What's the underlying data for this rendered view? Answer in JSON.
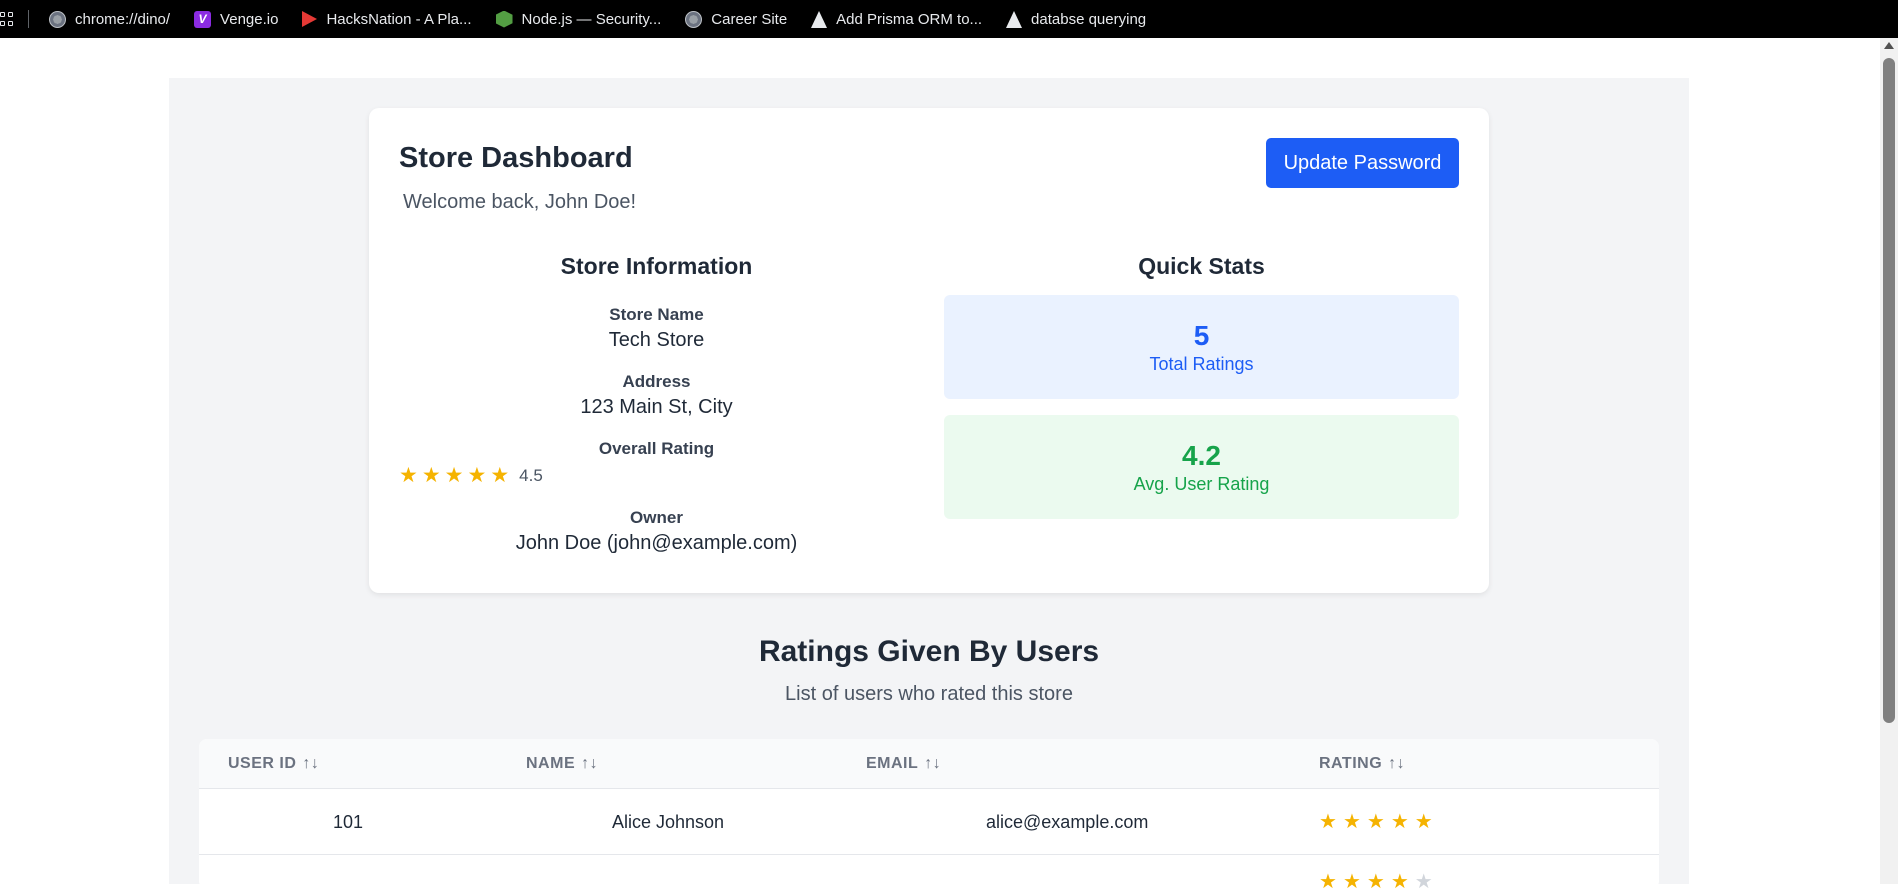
{
  "bookmarks": [
    {
      "label": "chrome://dino/",
      "icon": "globe-icon"
    },
    {
      "label": "Venge.io",
      "icon": "venge-icon"
    },
    {
      "label": "HacksNation - A Pla...",
      "icon": "flag-icon"
    },
    {
      "label": "Node.js — Security...",
      "icon": "nodejs-icon"
    },
    {
      "label": "Career Site",
      "icon": "globe-icon"
    },
    {
      "label": "Add Prisma ORM to...",
      "icon": "prisma-icon"
    },
    {
      "label": "databse querying",
      "icon": "prisma-icon"
    }
  ],
  "dashboard": {
    "title": "Store Dashboard",
    "welcome": "Welcome back, John Doe!",
    "update_password_label": "Update Password"
  },
  "store_info": {
    "section_title": "Store Information",
    "name_label": "Store Name",
    "name_value": "Tech Store",
    "address_label": "Address",
    "address_value": "123 Main St, City",
    "rating_label": "Overall Rating",
    "rating_stars": 5,
    "rating_value": "4.5",
    "owner_label": "Owner",
    "owner_value": "John Doe (john@example.com)"
  },
  "quick_stats": {
    "section_title": "Quick Stats",
    "total_ratings_value": "5",
    "total_ratings_label": "Total Ratings",
    "avg_rating_value": "4.2",
    "avg_rating_label": "Avg. User Rating"
  },
  "ratings": {
    "title": "Ratings Given By Users",
    "subtitle": "List of users who rated this store",
    "columns": [
      "USER ID",
      "NAME",
      "EMAIL",
      "RATING"
    ],
    "rows": [
      {
        "user_id": "101",
        "name": "Alice Johnson",
        "email": "alice@example.com",
        "stars": 5
      }
    ]
  },
  "colors": {
    "accent": "#1d5df5",
    "success": "#16a34a",
    "star": "#f5b301"
  }
}
